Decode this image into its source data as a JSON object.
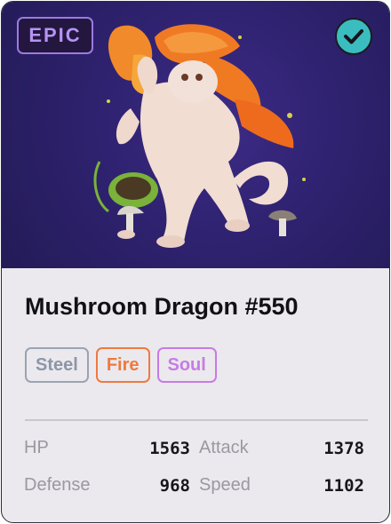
{
  "card": {
    "rarity": "EPIC",
    "verified_icon": "checkmark-icon",
    "title": "Mushroom Dragon #550",
    "artwork_icon": "mushroom-dragon-artwork",
    "tags": [
      {
        "label": "Steel",
        "color": "#8c96a8",
        "border": "#9aa3b4"
      },
      {
        "label": "Fire",
        "color": "#ee7a3f",
        "border": "#ee7a3f"
      },
      {
        "label": "Soul",
        "color": "#c77be6",
        "border": "#c77be6"
      }
    ],
    "stats": [
      {
        "label": "HP",
        "value": "1563"
      },
      {
        "label": "Attack",
        "value": "1378"
      },
      {
        "label": "Defense",
        "value": "968"
      },
      {
        "label": "Speed",
        "value": "1102"
      }
    ]
  },
  "colors": {
    "art_background": "#2f2270",
    "rarity_purple": "#b594f3",
    "verified_teal": "#3bbdc0",
    "card_background": "#ebe9ed"
  }
}
